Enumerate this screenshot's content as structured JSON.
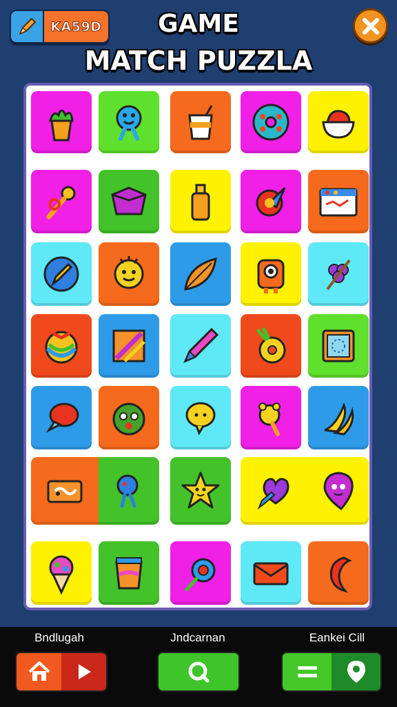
{
  "header": {
    "badge_label": "KA59D",
    "title_line1": "GAME",
    "title_line2": "MATCH PUZZLA"
  },
  "board": {
    "tiles": [
      {
        "icon": "plant-pot-icon",
        "color": "#f020e6"
      },
      {
        "icon": "blue-creature-icon",
        "color": "#5ee02c"
      },
      {
        "icon": "paper-cup-icon",
        "color": "#f56a1c"
      },
      {
        "icon": "donut-icon",
        "color": "#f020e6"
      },
      {
        "icon": "rice-bowl-icon",
        "color": "#fff200"
      },
      {
        "icon": "key-charm-icon",
        "color": "#f020e6"
      },
      {
        "icon": "purple-box-icon",
        "color": "#43c22a"
      },
      {
        "icon": "bottle-icon",
        "color": "#fff200"
      },
      {
        "icon": "shield-pin-icon",
        "color": "#f020e6"
      },
      {
        "icon": "map-card-icon",
        "color": "#f56a1c"
      },
      {
        "icon": "pencil-coin-icon",
        "color": "#5fe8f6"
      },
      {
        "icon": "sun-face-icon",
        "color": "#f56a1c"
      },
      {
        "icon": "leaf-icon",
        "color": "#2e9be8"
      },
      {
        "icon": "robot-face-icon",
        "color": "#fff200"
      },
      {
        "icon": "grape-flower-icon",
        "color": "#5fe8f6"
      },
      {
        "icon": "rainbow-ball-icon",
        "color": "#f04a1c"
      },
      {
        "icon": "striped-square-icon",
        "color": "#2e9be8"
      },
      {
        "icon": "crayon-icon",
        "color": "#5fe8f6"
      },
      {
        "icon": "pineapple-ring-icon",
        "color": "#f04a1c"
      },
      {
        "icon": "dotted-frame-icon",
        "color": "#5ee02c"
      },
      {
        "icon": "chat-bubble-icon",
        "color": "#2e9be8"
      },
      {
        "icon": "monster-face-icon",
        "color": "#f56a1c"
      },
      {
        "icon": "smile-bubble-icon",
        "color": "#5fe8f6"
      },
      {
        "icon": "bear-key-icon",
        "color": "#f020e6"
      },
      {
        "icon": "banana-icon",
        "color": "#2e9be8"
      },
      {
        "icon": "ticket-card-icon",
        "color": "#f56a1c"
      },
      {
        "icon": "jellyfish-icon",
        "color": "#43c22a"
      },
      {
        "icon": "star-face-icon",
        "color": "#43c22a"
      },
      {
        "icon": "heart-pencil-icon",
        "color": "#fff200"
      },
      {
        "icon": "ghost-pin-icon",
        "color": "#fff200"
      },
      {
        "icon": "ice-cream-icon",
        "color": "#fff200"
      },
      {
        "icon": "jar-icon",
        "color": "#43c22a"
      },
      {
        "icon": "lollipop-icon",
        "color": "#f020e6"
      },
      {
        "icon": "envelope-icon",
        "color": "#5fe8f6"
      },
      {
        "icon": "chili-icon",
        "color": "#f56a1c"
      }
    ]
  },
  "bottom": {
    "label_left": "Bndlugah",
    "label_mid": "Jndcarnan",
    "label_right": "Eankei Cill"
  }
}
